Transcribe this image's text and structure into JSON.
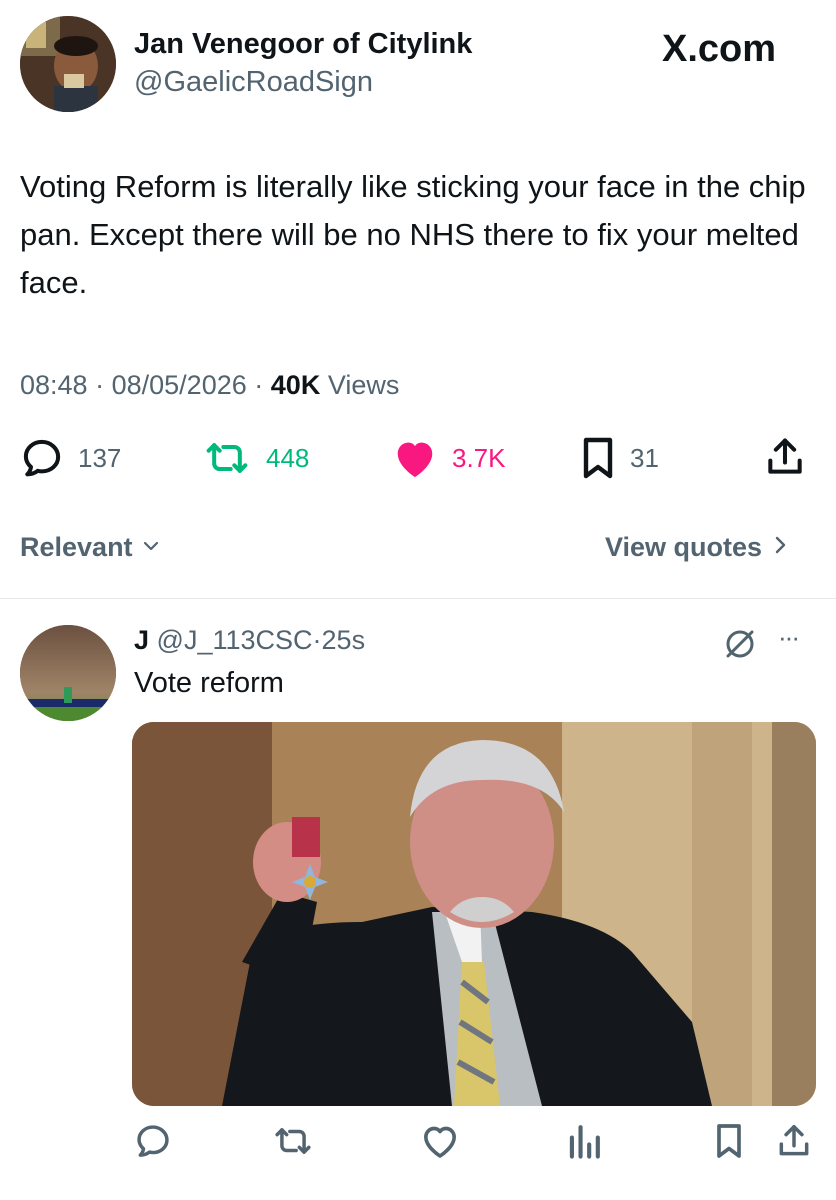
{
  "tweet": {
    "author_name": "Jan Venegoor of Citylink",
    "author_handle": "@GaelicRoadSign",
    "brand": "X.com",
    "text": "Voting Reform is literally like sticking your face in the chip pan. Except there will be no NHS there to fix your melted face.",
    "time": "08:48",
    "date": "08/05/2026",
    "views_count": "40K",
    "views_label": "Views",
    "separator": "·",
    "stats": {
      "replies": "137",
      "retweets": "448",
      "likes": "3.7K",
      "bookmarks": "31"
    }
  },
  "filter_bar": {
    "sort_label": "Relevant",
    "quotes_label": "View quotes"
  },
  "reply": {
    "author_name": "J",
    "author_handle": "@J_113CSC",
    "separator": "·",
    "time_ago": "25s",
    "text": "Vote reform",
    "more_label": "···"
  },
  "colors": {
    "like": "#f91880",
    "retweet": "#00ba7c",
    "secondary": "#536471",
    "primary_text": "#0f1419"
  },
  "icons": [
    "reply-icon",
    "retweet-icon",
    "heart-icon",
    "bookmark-icon",
    "share-icon",
    "chevron-down-icon",
    "chevron-right-icon",
    "grok-icon",
    "more-icon",
    "analytics-icon"
  ]
}
